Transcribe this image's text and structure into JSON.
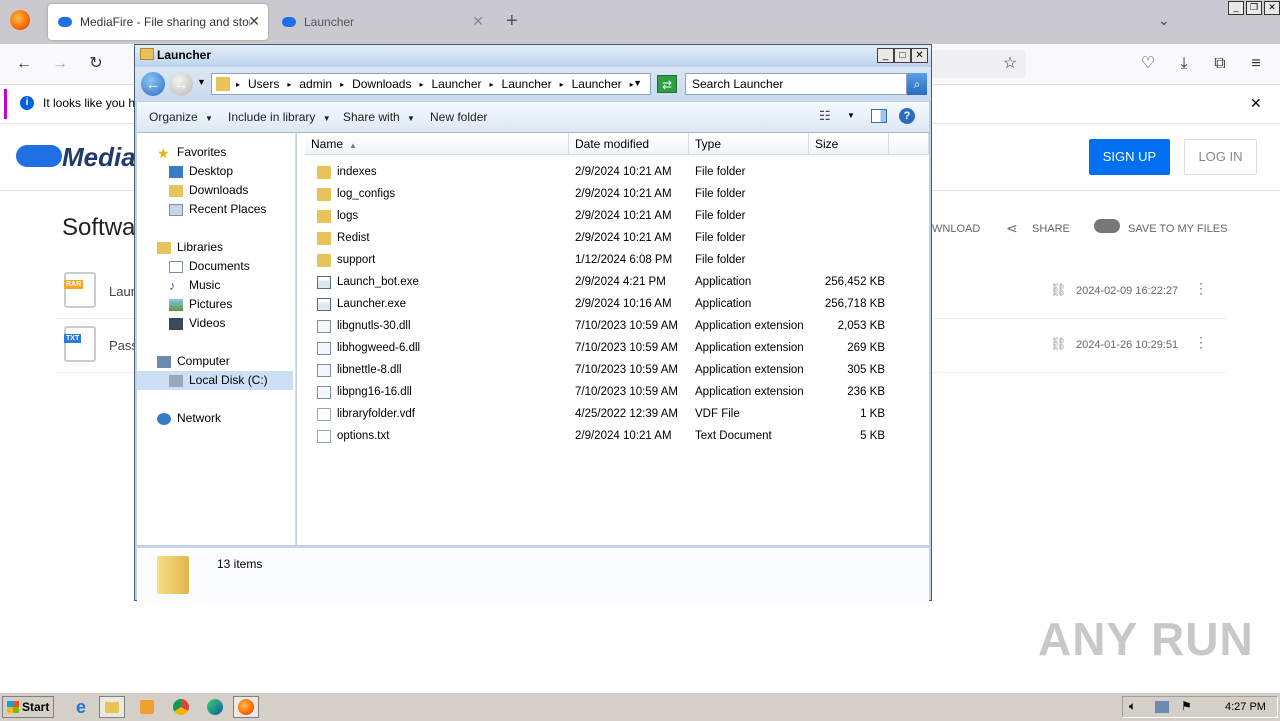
{
  "browser": {
    "tabs": [
      {
        "title": "MediaFire - File sharing and storag",
        "active": true
      },
      {
        "title": "Launcher",
        "active": false
      }
    ],
    "new_tab_symbol": "+",
    "notification_text": "It looks like you ha"
  },
  "mediafire": {
    "logo_text": "Media",
    "sign_up": "SIGN UP",
    "log_in": "LOG IN",
    "section_title": "Softwa",
    "actions": {
      "download": "WNLOAD",
      "share": "SHARE",
      "save": "SAVE TO MY FILES"
    },
    "files": [
      {
        "name": "Laun",
        "badge": "RAR",
        "date": "2024-02-09 16:22:27"
      },
      {
        "name": "Pass",
        "badge": "TXT",
        "date": "2024-01-26 10:29:51"
      }
    ]
  },
  "explorer": {
    "title": "Launcher",
    "breadcrumb": [
      "Users",
      "admin",
      "Downloads",
      "Launcher",
      "Launcher",
      "Launcher"
    ],
    "search_placeholder": "Search Launcher",
    "commands": {
      "organize": "Organize",
      "include": "Include in library",
      "share": "Share with",
      "new_folder": "New folder"
    },
    "nav": {
      "favorites": "Favorites",
      "desktop": "Desktop",
      "downloads": "Downloads",
      "recent": "Recent Places",
      "libraries": "Libraries",
      "documents": "Documents",
      "music": "Music",
      "pictures": "Pictures",
      "videos": "Videos",
      "computer": "Computer",
      "local_disk": "Local Disk (C:)",
      "network": "Network"
    },
    "columns": {
      "name": "Name",
      "date": "Date modified",
      "type": "Type",
      "size": "Size"
    },
    "files": [
      {
        "name": "indexes",
        "date": "2/9/2024 10:21 AM",
        "type": "File folder",
        "size": "",
        "kind": "folder"
      },
      {
        "name": "log_configs",
        "date": "2/9/2024 10:21 AM",
        "type": "File folder",
        "size": "",
        "kind": "folder"
      },
      {
        "name": "logs",
        "date": "2/9/2024 10:21 AM",
        "type": "File folder",
        "size": "",
        "kind": "folder"
      },
      {
        "name": "Redist",
        "date": "2/9/2024 10:21 AM",
        "type": "File folder",
        "size": "",
        "kind": "folder"
      },
      {
        "name": "support",
        "date": "1/12/2024 6:08 PM",
        "type": "File folder",
        "size": "",
        "kind": "folder"
      },
      {
        "name": "Launch_bot.exe",
        "date": "2/9/2024 4:21 PM",
        "type": "Application",
        "size": "256,452 KB",
        "kind": "exe"
      },
      {
        "name": "Launcher.exe",
        "date": "2/9/2024 10:16 AM",
        "type": "Application",
        "size": "256,718 KB",
        "kind": "exe"
      },
      {
        "name": "libgnutls-30.dll",
        "date": "7/10/2023 10:59 AM",
        "type": "Application extension",
        "size": "2,053 KB",
        "kind": "dll"
      },
      {
        "name": "libhogweed-6.dll",
        "date": "7/10/2023 10:59 AM",
        "type": "Application extension",
        "size": "269 KB",
        "kind": "dll"
      },
      {
        "name": "libnettle-8.dll",
        "date": "7/10/2023 10:59 AM",
        "type": "Application extension",
        "size": "305 KB",
        "kind": "dll"
      },
      {
        "name": "libpng16-16.dll",
        "date": "7/10/2023 10:59 AM",
        "type": "Application extension",
        "size": "236 KB",
        "kind": "dll"
      },
      {
        "name": "libraryfolder.vdf",
        "date": "4/25/2022 12:39 AM",
        "type": "VDF File",
        "size": "1 KB",
        "kind": "file"
      },
      {
        "name": "options.txt",
        "date": "2/9/2024 10:21 AM",
        "type": "Text Document",
        "size": "5 KB",
        "kind": "file"
      }
    ],
    "status": "13 items"
  },
  "taskbar": {
    "start": "Start",
    "clock": "4:27 PM"
  },
  "watermark": "ANY RUN",
  "colors": {
    "mf_blue": "#0070f0",
    "folder": "#e8c35a",
    "nav_selected": "#cce0f5"
  }
}
